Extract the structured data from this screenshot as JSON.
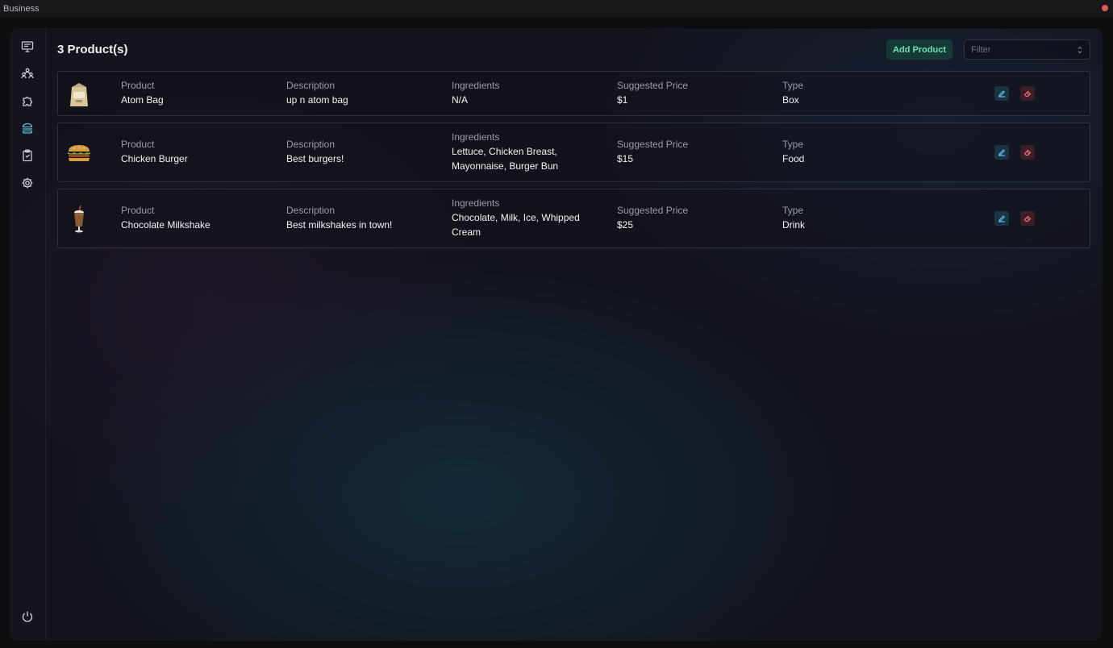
{
  "app": {
    "window_title": "Business"
  },
  "sidebar": {
    "items": [
      {
        "name": "monitor-icon"
      },
      {
        "name": "users-icon"
      },
      {
        "name": "puzzle-icon"
      },
      {
        "name": "burger-icon",
        "active": true
      },
      {
        "name": "clipboard-icon"
      },
      {
        "name": "gear-icon"
      }
    ],
    "power": {
      "name": "power-icon"
    }
  },
  "header": {
    "title": "3 Product(s)",
    "add_label": "Add Product",
    "filter_placeholder": "Filter"
  },
  "columns": {
    "product": "Product",
    "description": "Description",
    "ingredients": "Ingredients",
    "price": "Suggested Price",
    "type": "Type"
  },
  "products": [
    {
      "image": "bag-icon",
      "name": "Atom Bag",
      "description": "up n atom bag",
      "ingredients": [
        "N/A"
      ],
      "price": "$1",
      "type": "Box"
    },
    {
      "image": "burger-food-icon",
      "name": "Chicken Burger",
      "description": "Best burgers!",
      "ingredients": [
        "Lettuce, Chicken Breast,",
        "Mayonnaise, Burger Bun"
      ],
      "price": "$15",
      "type": "Food"
    },
    {
      "image": "milkshake-icon",
      "name": "Chocolate Milkshake",
      "description": "Best milkshakes in town!",
      "ingredients": [
        "Chocolate, Milk, Ice, Whipped",
        "Cream"
      ],
      "price": "$25",
      "type": "Drink"
    }
  ],
  "colors": {
    "accent_green": "#6ee0b8",
    "edit_blue": "#56b8e4",
    "delete_red": "#f06a75",
    "active_nav": "#5fb7d6"
  }
}
